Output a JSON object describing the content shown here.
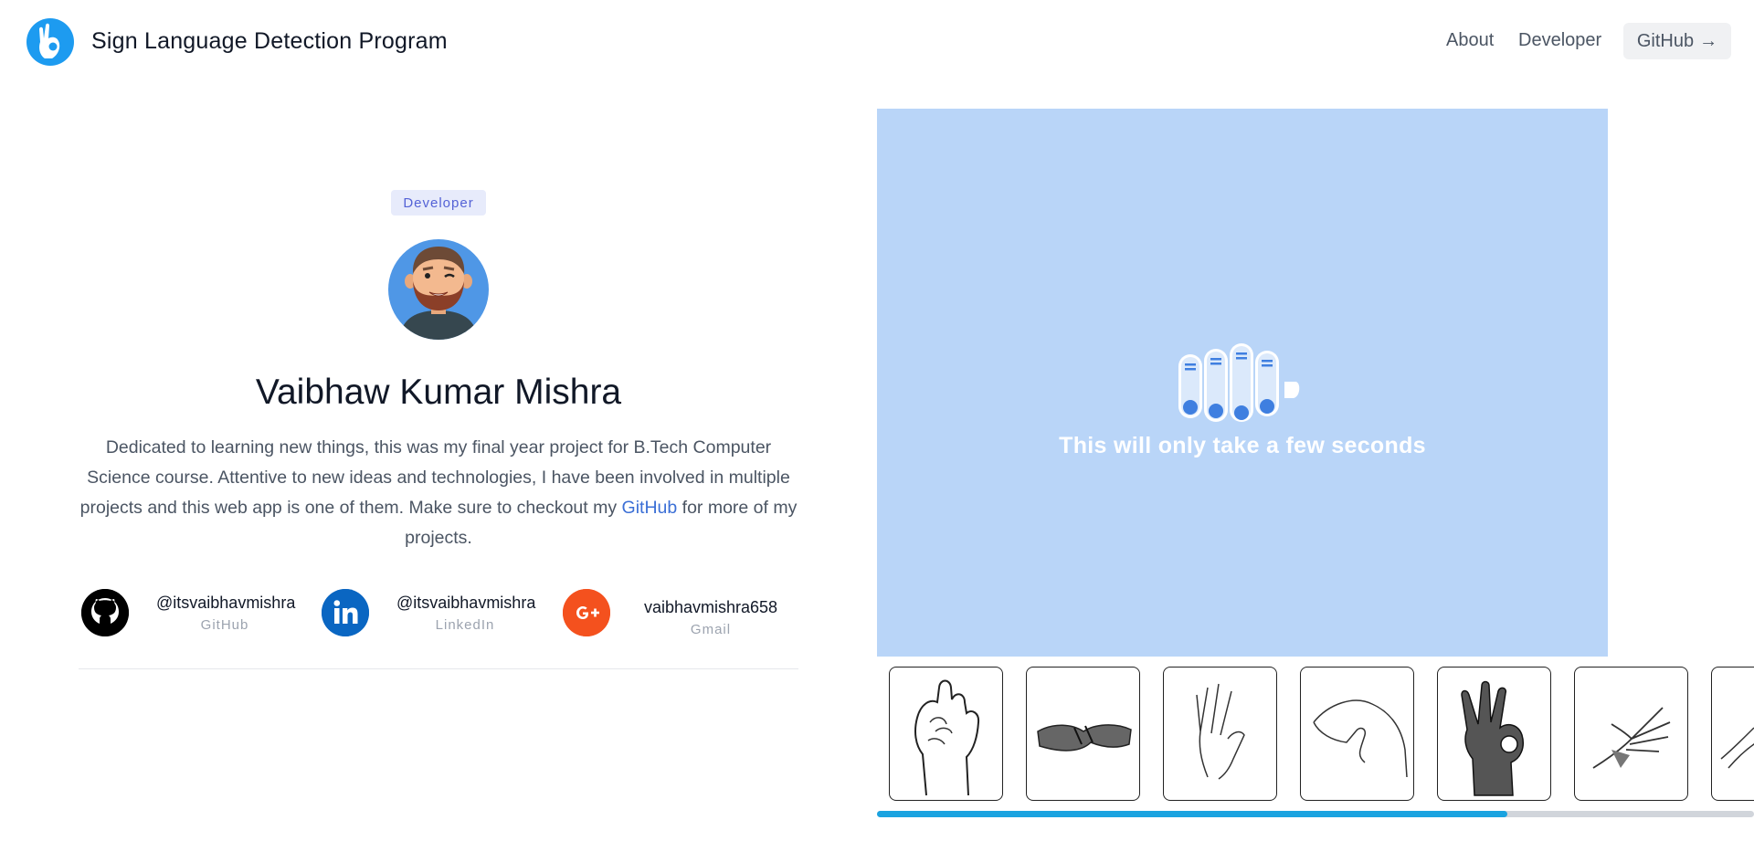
{
  "header": {
    "app_title": "Sign Language Detection Program",
    "logo_icon": "ok-hand-icon",
    "nav": {
      "about": "About",
      "developer": "Developer",
      "github": "GitHub",
      "github_arrow": "→"
    }
  },
  "developer": {
    "badge": "Developer",
    "name": "Vaibhaw Kumar Mishra",
    "bio_before_link": "Dedicated to learning new things, this was my final year project for B.Tech Computer Science course. Attentive to new ideas and technologies, I have been involved in multiple projects and this web app is one of them. Make sure to checkout my ",
    "bio_link": "GitHub",
    "bio_after_link": " for more of my projects.",
    "socials": [
      {
        "handle": "@itsvaibhavmishra",
        "platform": "GitHub",
        "icon": "github-icon",
        "color": "#000000"
      },
      {
        "handle": "@itsvaibhavmishra",
        "platform": "LinkedIn",
        "icon": "linkedin-icon",
        "color": "#0a66c2"
      },
      {
        "handle": "vaibhavmishra658",
        "platform": "Gmail",
        "icon": "google-plus-icon",
        "color": "#f4511e"
      }
    ]
  },
  "panel": {
    "loading_text": "This will only take a few seconds",
    "background": "#b9d5f8",
    "loader_icon": "hand-fingers-loader-icon"
  },
  "signs": [
    {
      "icon": "sign-fist-icon"
    },
    {
      "icon": "sign-handshake-icon"
    },
    {
      "icon": "sign-open-hand-icon"
    },
    {
      "icon": "sign-c-shape-icon"
    },
    {
      "icon": "sign-ok-icon"
    },
    {
      "icon": "sign-flat-hand-icon"
    },
    {
      "icon": "sign-partial-icon"
    }
  ],
  "colors": {
    "accent": "#1d9bf0",
    "scroll_thumb": "#1aa3e0",
    "link": "#3b6fd6"
  }
}
